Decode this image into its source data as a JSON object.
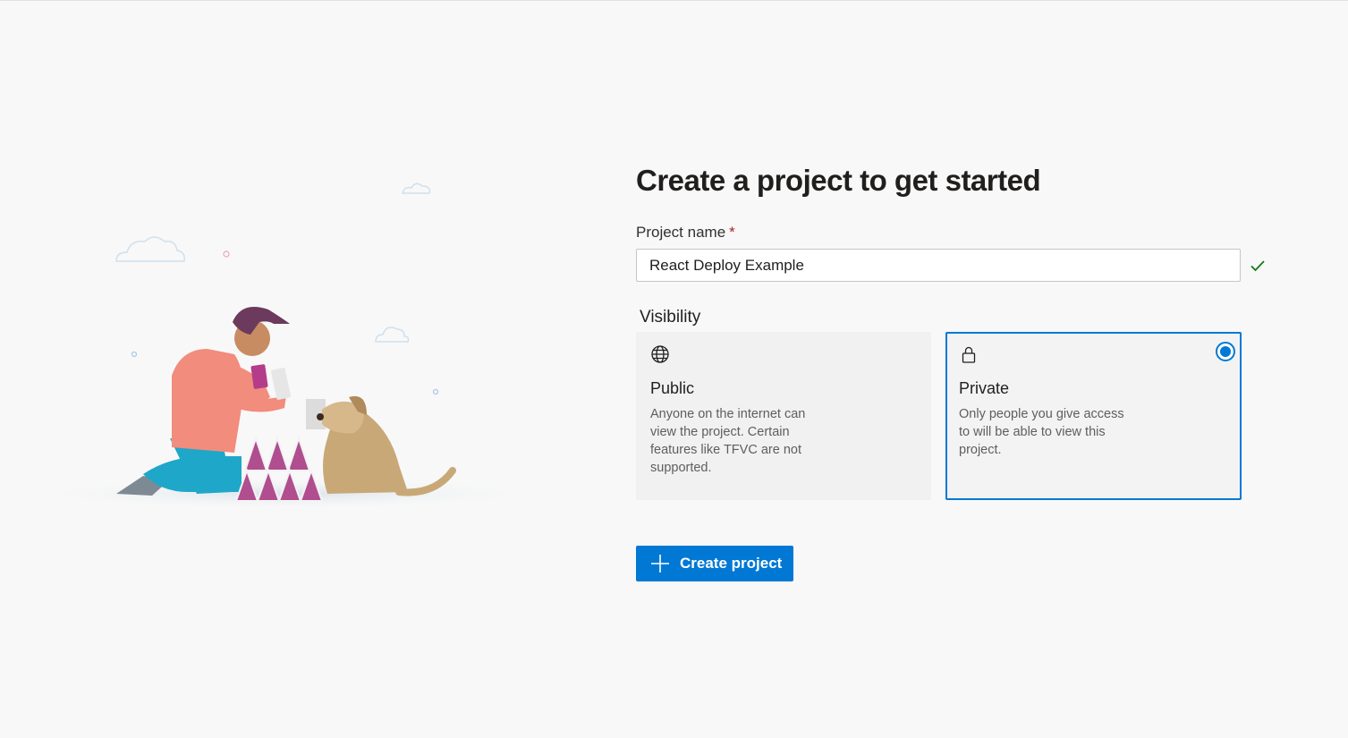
{
  "page": {
    "title": "Create a project to get started"
  },
  "form": {
    "project_name_label": "Project name",
    "required_marker": "*",
    "project_name_value": "React Deploy Example",
    "visibility_label": "Visibility"
  },
  "visibility_options": [
    {
      "icon": "globe-icon",
      "title": "Public",
      "description": "Anyone on the internet can view the project. Certain features like TFVC are not supported.",
      "selected": false
    },
    {
      "icon": "lock-icon",
      "title": "Private",
      "description": "Only people you give access to will be able to view this project.",
      "selected": true
    }
  ],
  "actions": {
    "create_label": "Create project"
  },
  "colors": {
    "accent": "#0078d4",
    "valid_check": "#107c10",
    "required": "#a4262c",
    "background": "#f8f8f8"
  }
}
